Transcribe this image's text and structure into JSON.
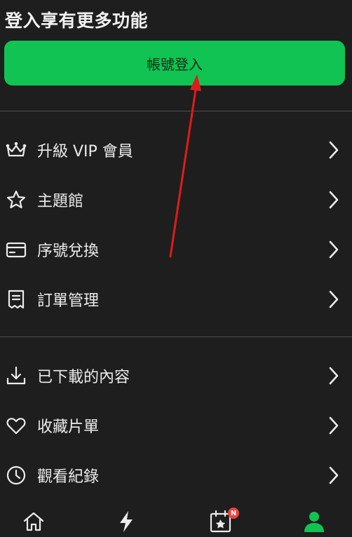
{
  "header": {
    "title": "登入享有更多功能"
  },
  "login": {
    "label": "帳號登入"
  },
  "menu_group_1": [
    {
      "label": "升級 VIP 會員",
      "icon": "crown-icon"
    },
    {
      "label": "主題館",
      "icon": "star-icon"
    },
    {
      "label": "序號兌換",
      "icon": "card-icon"
    },
    {
      "label": "訂單管理",
      "icon": "receipt-icon"
    }
  ],
  "menu_group_2": [
    {
      "label": "已下載的內容",
      "icon": "download-icon"
    },
    {
      "label": "收藏片單",
      "icon": "heart-icon"
    },
    {
      "label": "觀看紀錄",
      "icon": "clock-icon"
    }
  ],
  "nav": {
    "items": [
      "home-icon",
      "lightning-icon",
      "calendar-star-icon",
      "person-icon"
    ],
    "badge": "N",
    "active_color": "#10c352"
  },
  "colors": {
    "accent": "#10c352",
    "annotation_arrow": "#e01b1b",
    "badge": "#e8453c"
  }
}
